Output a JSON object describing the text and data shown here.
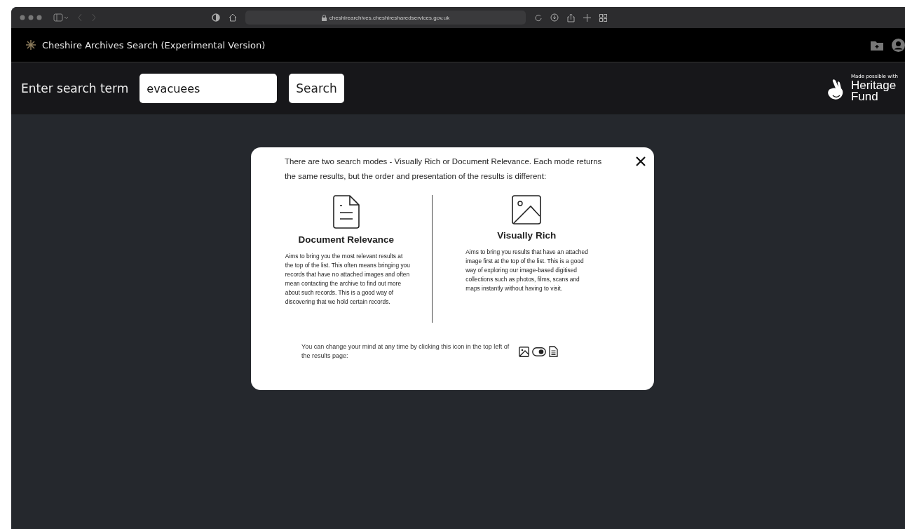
{
  "browser": {
    "url": "cheshirearchives.cheshiresharedservices.gov.uk"
  },
  "app_bar": {
    "title": "Cheshire Archives Search (Experimental Version)"
  },
  "search": {
    "label": "Enter search term",
    "value": "evacuees",
    "button": "Search"
  },
  "logo": {
    "tagline": "Made possible with",
    "line_1": "Heritage",
    "line_2": "Fund"
  },
  "modal": {
    "intro": "There are two search modes - Visually Rich or Document Relevance. Each mode returns the same results, but the order and presentation of the results is different:",
    "modes": [
      {
        "kind": "document",
        "title": "Document Relevance",
        "text": "Aims to bring you the most relevant results at the top of the list. This often means bringing you records that have no attached images and often mean contacting the archive to find out more about such records. This is a good way of discovering that we hold certain records."
      },
      {
        "kind": "image",
        "title": "Visually Rich",
        "text": "Aims to bring you results that have an attached image first at the top of the list. This is a good way of exploring our image-based digitised collections such as photos, films, scans and maps instantly without having to visit."
      }
    ],
    "footer": "You can change your mind at any time by clicking this icon in the top left of the results page:"
  }
}
